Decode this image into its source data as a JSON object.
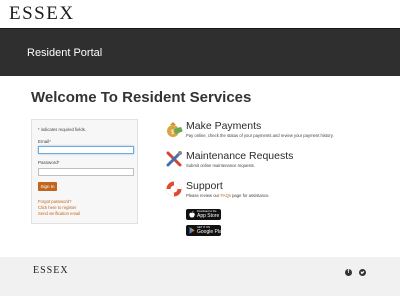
{
  "brand": {
    "logo_text": "ESSEX"
  },
  "header": {
    "title": "Resident Portal"
  },
  "main": {
    "heading": "Welcome To Resident Services"
  },
  "login": {
    "required_note": "* indicates required fields.",
    "email_label": "Email",
    "email_value": "",
    "password_label": "Password",
    "password_value": "",
    "required_marker": "*",
    "signin_label": "Sign In",
    "forgot_password": "Forgot password?",
    "register": "Click here to register",
    "verification": "Send verification email"
  },
  "services": [
    {
      "icon": "money-bag-icon",
      "title": "Make Payments",
      "desc": "Pay online, check the status of your payments and review your payment history."
    },
    {
      "icon": "tools-icon",
      "title": "Maintenance Requests",
      "desc": "Submit online maintenance requests."
    },
    {
      "icon": "lifebuoy-icon",
      "title": "Support",
      "desc_pre": "Please review our ",
      "desc_link": "FAQs",
      "desc_post": " page for assistance."
    }
  ],
  "apps": {
    "appstore_small": "Download on the",
    "appstore_big": "App Store",
    "googleplay_small": "GET IT ON",
    "googleplay_big": "Google Play"
  },
  "footer": {
    "logo_text": "ESSEX",
    "social": [
      "facebook-icon",
      "twitter-icon"
    ]
  },
  "colors": {
    "accent": "#c0651b",
    "header_bg": "#2f2f2f",
    "footer_bg": "#f1f1f1"
  }
}
